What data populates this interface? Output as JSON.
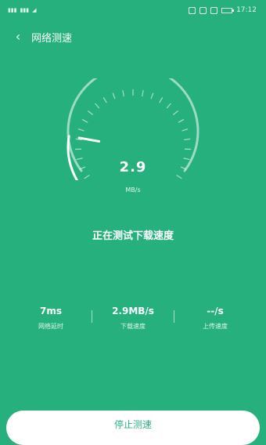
{
  "status_bar": {
    "left_signals": [
      "4G",
      "4G"
    ],
    "time": "17:12",
    "icons": [
      "alarm-icon",
      "nfc-icon",
      "vibrate-icon",
      "battery-icon"
    ]
  },
  "header": {
    "back_label": "‹",
    "title": "网络测速"
  },
  "gauge": {
    "speed_value": "2.9",
    "speed_unit": "MB/s",
    "needle_fraction": 0.22
  },
  "status_text": "正在测试下载速度",
  "stats": [
    {
      "value": "7ms",
      "label": "网络延时"
    },
    {
      "value": "2.9MB/s",
      "label": "下载速度"
    },
    {
      "value": "--/s",
      "label": "上传速度"
    }
  ],
  "stop_button": {
    "label": "停止测速"
  },
  "colors": {
    "background": "#25b07e",
    "button_text": "#2bb380"
  }
}
